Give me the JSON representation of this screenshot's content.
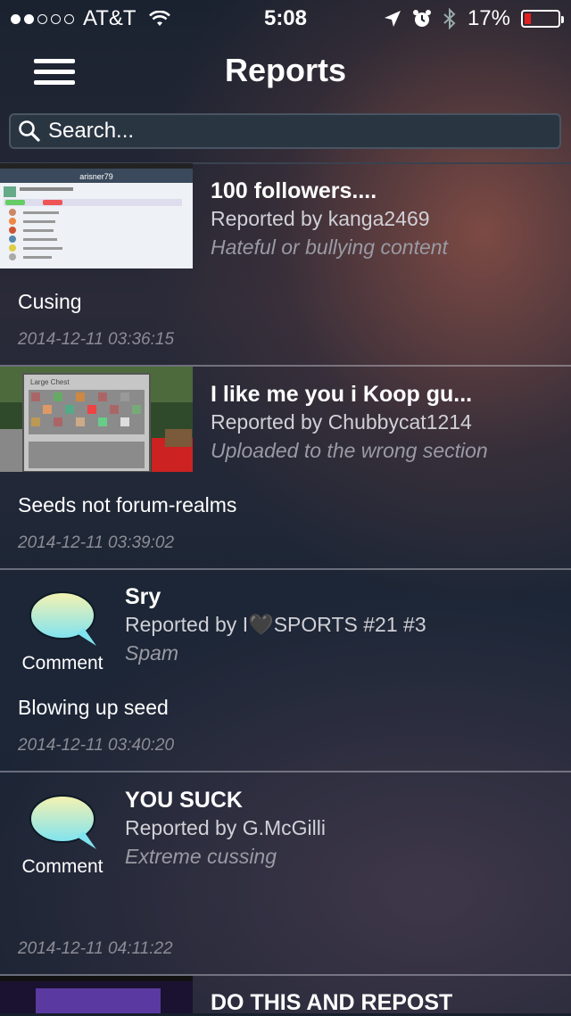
{
  "status_bar": {
    "carrier": "AT&T",
    "time": "5:08",
    "battery_percent": "17%",
    "signal_dots_filled": 2,
    "signal_dots_total": 5
  },
  "nav": {
    "title": "Reports",
    "menu_icon": "hamburger-menu-icon"
  },
  "search": {
    "placeholder": "Search..."
  },
  "reports": [
    {
      "title": "100 followers....",
      "reported_by": "Reported by kanga2469",
      "reason": "Hateful or bullying content",
      "comment": "Cusing",
      "date": "2014-12-11 03:36:15",
      "thumb_text": "arisner79"
    },
    {
      "title": "I like me you i Koop gu...",
      "reported_by": "Reported by Chubbycat1214",
      "reason": "Uploaded to the wrong section",
      "comment": "Seeds not forum-realms",
      "date": "2014-12-11 03:39:02",
      "thumb_text": "Large Chest"
    },
    {
      "title": "Sry",
      "reported_by": "Reported by I🖤SPORTS #21 #3",
      "reason": "Spam",
      "comment": "Blowing up seed",
      "date": "2014-12-11 03:40:20",
      "type_label": "Comment"
    },
    {
      "title": "YOU SUCK",
      "reported_by": "Reported by G.McGilli",
      "reason": "Extreme cussing",
      "comment": "",
      "date": "2014-12-11 04:11:22",
      "type_label": "Comment"
    },
    {
      "title": "DO THIS AND REPOST"
    }
  ],
  "colors": {
    "accent_red": "#e02020",
    "background": "#17202c"
  }
}
